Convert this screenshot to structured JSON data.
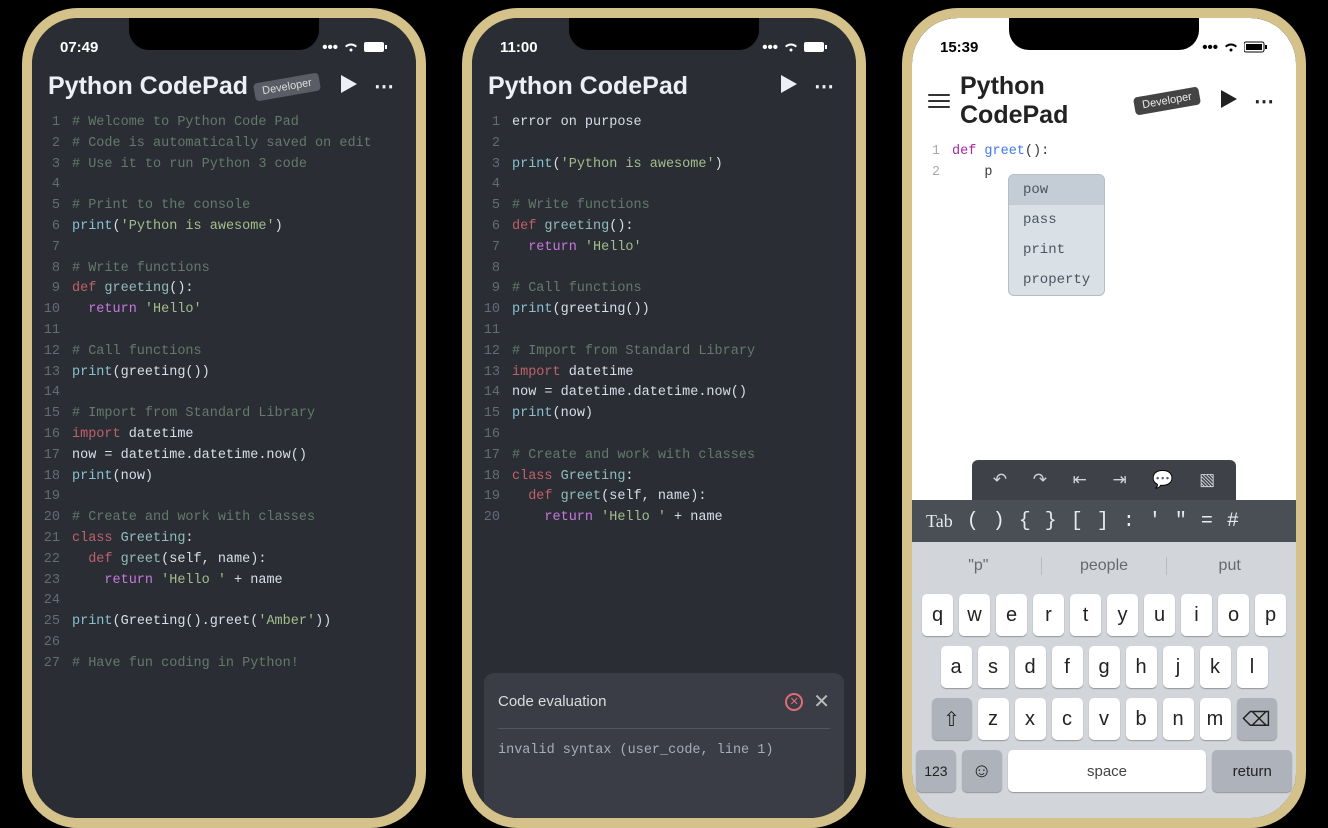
{
  "phones": [
    {
      "time": "07:49",
      "theme": "dark",
      "title": "Python CodePad",
      "badge": "Developer",
      "showMenu": false,
      "code": [
        [
          {
            "t": "# Welcome to Python Code Pad",
            "c": "comment"
          }
        ],
        [
          {
            "t": "# Code is automatically saved on edit",
            "c": "comment"
          }
        ],
        [
          {
            "t": "# Use it to run Python 3 code",
            "c": "comment"
          }
        ],
        [],
        [
          {
            "t": "# Print to the console",
            "c": "comment"
          }
        ],
        [
          {
            "t": "print",
            "c": "builtin"
          },
          {
            "t": "(",
            "c": ""
          },
          {
            "t": "'Python is awesome'",
            "c": "string"
          },
          {
            "t": ")",
            "c": ""
          }
        ],
        [],
        [
          {
            "t": "# Write functions",
            "c": "comment"
          }
        ],
        [
          {
            "t": "def ",
            "c": "def"
          },
          {
            "t": "greeting",
            "c": "func"
          },
          {
            "t": "():",
            "c": ""
          }
        ],
        [
          {
            "t": "  ",
            "c": ""
          },
          {
            "t": "return ",
            "c": "keyword"
          },
          {
            "t": "'Hello'",
            "c": "string"
          }
        ],
        [],
        [
          {
            "t": "# Call functions",
            "c": "comment"
          }
        ],
        [
          {
            "t": "print",
            "c": "builtin"
          },
          {
            "t": "(greeting())",
            "c": ""
          }
        ],
        [],
        [
          {
            "t": "# Import from Standard Library",
            "c": "comment"
          }
        ],
        [
          {
            "t": "import ",
            "c": "def"
          },
          {
            "t": "datetime",
            "c": "ident"
          }
        ],
        [
          {
            "t": "now = datetime.datetime.now()",
            "c": "ident"
          }
        ],
        [
          {
            "t": "print",
            "c": "builtin"
          },
          {
            "t": "(now)",
            "c": ""
          }
        ],
        [],
        [
          {
            "t": "# Create and work with classes",
            "c": "comment"
          }
        ],
        [
          {
            "t": "class ",
            "c": "def"
          },
          {
            "t": "Greeting",
            "c": "func"
          },
          {
            "t": ":",
            "c": ""
          }
        ],
        [
          {
            "t": "  ",
            "c": ""
          },
          {
            "t": "def ",
            "c": "def"
          },
          {
            "t": "greet",
            "c": "func"
          },
          {
            "t": "(self, name):",
            "c": ""
          }
        ],
        [
          {
            "t": "    ",
            "c": ""
          },
          {
            "t": "return ",
            "c": "keyword"
          },
          {
            "t": "'Hello ' ",
            "c": "string"
          },
          {
            "t": "+ name",
            "c": ""
          }
        ],
        [],
        [
          {
            "t": "print",
            "c": "builtin"
          },
          {
            "t": "(Greeting().greet(",
            "c": ""
          },
          {
            "t": "'Amber'",
            "c": "string"
          },
          {
            "t": "))",
            "c": ""
          }
        ],
        [],
        [
          {
            "t": "# Have fun coding in Python!",
            "c": "comment"
          }
        ]
      ]
    },
    {
      "time": "11:00",
      "theme": "dark",
      "title": "Python CodePad",
      "badge": null,
      "showMenu": false,
      "code": [
        [
          {
            "t": "error on purpose",
            "c": "ident"
          }
        ],
        [],
        [
          {
            "t": "print",
            "c": "builtin"
          },
          {
            "t": "(",
            "c": ""
          },
          {
            "t": "'Python is awesome'",
            "c": "string"
          },
          {
            "t": ")",
            "c": ""
          }
        ],
        [],
        [
          {
            "t": "# Write functions",
            "c": "comment"
          }
        ],
        [
          {
            "t": "def ",
            "c": "def"
          },
          {
            "t": "greeting",
            "c": "func"
          },
          {
            "t": "():",
            "c": ""
          }
        ],
        [
          {
            "t": "  ",
            "c": ""
          },
          {
            "t": "return ",
            "c": "keyword"
          },
          {
            "t": "'Hello'",
            "c": "string"
          }
        ],
        [],
        [
          {
            "t": "# Call functions",
            "c": "comment"
          }
        ],
        [
          {
            "t": "print",
            "c": "builtin"
          },
          {
            "t": "(greeting())",
            "c": ""
          }
        ],
        [],
        [
          {
            "t": "# Import from Standard Library",
            "c": "comment"
          }
        ],
        [
          {
            "t": "import ",
            "c": "def"
          },
          {
            "t": "datetime",
            "c": "ident"
          }
        ],
        [
          {
            "t": "now = datetime.datetime.now()",
            "c": "ident"
          }
        ],
        [
          {
            "t": "print",
            "c": "builtin"
          },
          {
            "t": "(now)",
            "c": ""
          }
        ],
        [],
        [
          {
            "t": "# Create and work with classes",
            "c": "comment"
          }
        ],
        [
          {
            "t": "class ",
            "c": "def"
          },
          {
            "t": "Greeting",
            "c": "func"
          },
          {
            "t": ":",
            "c": ""
          }
        ],
        [
          {
            "t": "  ",
            "c": ""
          },
          {
            "t": "def ",
            "c": "def"
          },
          {
            "t": "greet",
            "c": "func"
          },
          {
            "t": "(self, name):",
            "c": ""
          }
        ],
        [
          {
            "t": "    ",
            "c": ""
          },
          {
            "t": "return ",
            "c": "keyword"
          },
          {
            "t": "'Hello ' ",
            "c": "string"
          },
          {
            "t": "+ name",
            "c": ""
          }
        ]
      ],
      "eval": {
        "title": "Code evaluation",
        "error": true,
        "message": "invalid syntax (user_code, line 1)"
      }
    },
    {
      "time": "15:39",
      "theme": "light",
      "title": "Python CodePad",
      "badge": "Developer",
      "showMenu": true,
      "code": [
        [
          {
            "t": "def ",
            "c": "def"
          },
          {
            "t": "greet",
            "c": "func"
          },
          {
            "t": "():",
            "c": ""
          }
        ],
        [
          {
            "t": "    p",
            "c": "ident"
          }
        ]
      ],
      "autocomplete": [
        "pow",
        "pass",
        "print",
        "property"
      ],
      "toolbar1": [
        "↶",
        "↷",
        "⇤",
        "⇥",
        "💬",
        "▧"
      ],
      "toolbar2": [
        "Tab",
        "(",
        ")",
        "{",
        "}",
        "[",
        "]",
        ":",
        "'",
        "\"",
        "=",
        "#"
      ],
      "suggestions": [
        "\"p\"",
        "people",
        "put"
      ],
      "keyboard": {
        "rows": [
          [
            "q",
            "w",
            "e",
            "r",
            "t",
            "y",
            "u",
            "i",
            "o",
            "p"
          ],
          [
            "a",
            "s",
            "d",
            "f",
            "g",
            "h",
            "j",
            "k",
            "l"
          ],
          [
            "⇧",
            "z",
            "x",
            "c",
            "v",
            "b",
            "n",
            "m",
            "⌫"
          ]
        ],
        "bottom": {
          "num": "123",
          "emoji": "☺",
          "space": "space",
          "return": "return"
        }
      }
    }
  ]
}
